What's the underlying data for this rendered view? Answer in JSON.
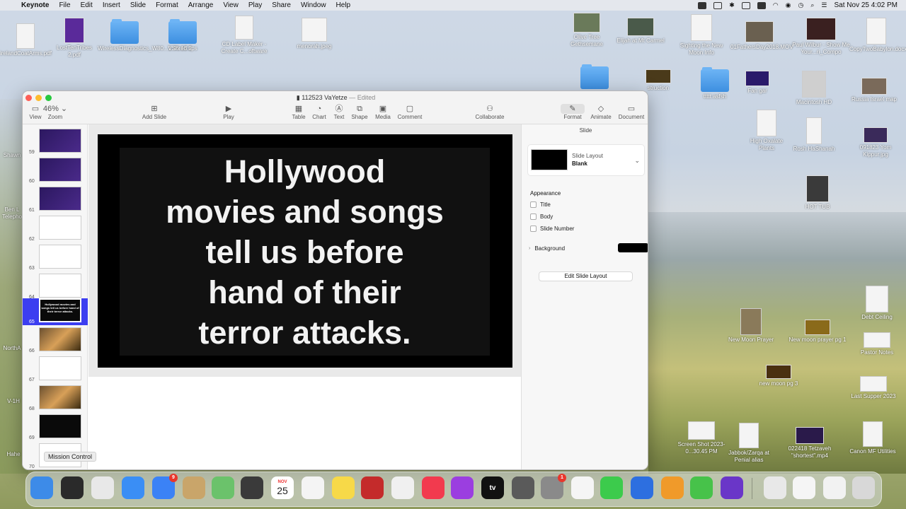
{
  "menubar": {
    "app": "Keynote",
    "items": [
      "File",
      "Edit",
      "Insert",
      "Slide",
      "Format",
      "Arrange",
      "View",
      "Play",
      "Share",
      "Window",
      "Help"
    ],
    "datetime": "Sat Nov 25  4:02 PM"
  },
  "desktop": {
    "icons": [
      {
        "label": "irelandCoatArms.pdf",
        "kind": "doc"
      },
      {
        "label": "LostTenTribes 2.pdf",
        "kind": "photo"
      },
      {
        "label": "WirelessDiagnostics_W80...1.46.15.2",
        "kind": "folder"
      },
      {
        "label": "VShred tips",
        "kind": "folder"
      },
      {
        "label": "CD Label Maker - Create C...oftware",
        "kind": "doc"
      },
      {
        "label": "menorah.jpeg",
        "kind": "doc"
      },
      {
        "label": "Olive Tree Gethsemane",
        "kind": "photo"
      },
      {
        "label": "Elijah at Mt Carmel",
        "kind": "photo"
      },
      {
        "label": "Sighting the New Moon Info",
        "kind": "doc"
      },
      {
        "label": "01FathersDay2018.MOV",
        "kind": "photo"
      },
      {
        "label": "Paul Wilbur - Show Me Your...ri_Compo",
        "kind": "photo"
      },
      {
        "label": "CopyTwoBabylon.docx",
        "kind": "doc"
      },
      {
        "label": "Fan gar",
        "kind": "photo"
      },
      {
        "label": "Macintosh HD",
        "kind": "doc"
      },
      {
        "label": "Russia Israel map",
        "kind": "photo"
      },
      {
        "label": "High Oxalate Plants",
        "kind": "doc"
      },
      {
        "label": "Rosh HaShanah",
        "kind": "doc"
      },
      {
        "label": "091823 Yom Kippur.jpg",
        "kind": "photo"
      },
      {
        "label": "HOT TUB",
        "kind": "doc"
      },
      {
        "label": "Debt Ceiling",
        "kind": "doc"
      },
      {
        "label": "New Moon Prayer",
        "kind": "doc"
      },
      {
        "label": "New moon prayer pg 1",
        "kind": "photo"
      },
      {
        "label": "Pastor Notes",
        "kind": "doc"
      },
      {
        "label": "new moon pg 3",
        "kind": "photo"
      },
      {
        "label": "Last Supper 2023",
        "kind": "doc"
      },
      {
        "label": "Screen Shot 2023-0...30.45 PM",
        "kind": "doc"
      },
      {
        "label": "Jabbok/Zarqa at Penial alias",
        "kind": "doc"
      },
      {
        "label": "022418 Tetzaveh \"shortest\".mp4",
        "kind": "photo"
      },
      {
        "label": "Canon MF Utilities",
        "kind": "doc"
      },
      {
        "label": "struction",
        "kind": "photo"
      },
      {
        "label": "ttttt.asfsh",
        "kind": "folder"
      },
      {
        "label": "Shawn",
        "kind": "doc"
      },
      {
        "label": "Ben L Telepho",
        "kind": "doc"
      },
      {
        "label": "NorthA",
        "kind": "doc"
      },
      {
        "label": "V-1H",
        "kind": "doc"
      },
      {
        "label": "Hahe",
        "kind": "doc"
      }
    ]
  },
  "window": {
    "title": "112523 VaYetze",
    "status": "Edited",
    "toolbar": {
      "view": "View",
      "zoom_value": "46%",
      "zoom": "Zoom",
      "add_slide": "Add Slide",
      "play": "Play",
      "table": "Table",
      "chart": "Chart",
      "text": "Text",
      "shape": "Shape",
      "media": "Media",
      "comment": "Comment",
      "collaborate": "Collaborate",
      "format": "Format",
      "animate": "Animate",
      "document": "Document"
    },
    "navigator": [
      {
        "num": "59",
        "style": "purple",
        "text": ""
      },
      {
        "num": "60",
        "style": "purple",
        "text": ""
      },
      {
        "num": "61",
        "style": "purple",
        "text": ""
      },
      {
        "num": "62",
        "style": "white",
        "text": ""
      },
      {
        "num": "63",
        "style": "white",
        "text": ""
      },
      {
        "num": "64",
        "style": "white",
        "text": ""
      },
      {
        "num": "65",
        "style": "black",
        "text": "Hollywood movies and songs tell us before hand of their terror attacks.",
        "selected": true
      },
      {
        "num": "66",
        "style": "photo",
        "text": ""
      },
      {
        "num": "67",
        "style": "white",
        "text": ""
      },
      {
        "num": "68",
        "style": "photo",
        "text": ""
      },
      {
        "num": "69",
        "style": "black",
        "text": ""
      },
      {
        "num": "70",
        "style": "white",
        "text": ""
      }
    ],
    "slide": {
      "text": "Hollywood\nmovies and songs\ntell us before\nhand of their\nterror attacks."
    },
    "inspector": {
      "header": "Slide",
      "layout_label": "Slide Layout",
      "layout_name": "Blank",
      "appearance": "Appearance",
      "options": [
        {
          "label": "Title",
          "checked": false
        },
        {
          "label": "Body",
          "checked": false
        },
        {
          "label": "Slide Number",
          "checked": false
        }
      ],
      "background_label": "Background",
      "background_color": "#000000",
      "edit_layout": "Edit Slide Layout"
    }
  },
  "tooltip": "Mission Control",
  "dock": {
    "apps": [
      {
        "name": "finder-icon",
        "color": "#3d8be8"
      },
      {
        "name": "mission-control-icon",
        "color": "#2a2a2a"
      },
      {
        "name": "launchpad-icon",
        "color": "#e8e8e8"
      },
      {
        "name": "safari-icon",
        "color": "#3a8ef5"
      },
      {
        "name": "mail-icon",
        "color": "#3b82f6",
        "badge": "9"
      },
      {
        "name": "contacts-icon",
        "color": "#c9a56a"
      },
      {
        "name": "maps-icon",
        "color": "#6bc26b"
      },
      {
        "name": "calculator-icon",
        "color": "#3a3a3a"
      },
      {
        "name": "calendar-icon",
        "color": "#ffffff",
        "label": "25",
        "month": "NOV"
      },
      {
        "name": "reminders-icon",
        "color": "#f4f4f4"
      },
      {
        "name": "notes-icon",
        "color": "#f7d948"
      },
      {
        "name": "photo-booth-icon",
        "color": "#c42b2b"
      },
      {
        "name": "photos-icon",
        "color": "#f0f0f0"
      },
      {
        "name": "music-icon",
        "color": "#f23a4e"
      },
      {
        "name": "podcasts-icon",
        "color": "#9b3ee0"
      },
      {
        "name": "tv-icon",
        "color": "#111111",
        "label": "tv"
      },
      {
        "name": "preview-icon",
        "color": "#5a5a5a"
      },
      {
        "name": "system-settings-icon",
        "color": "#8a8a8a",
        "badge": "1"
      },
      {
        "name": "pages-icon",
        "color": "#f5f5f5"
      },
      {
        "name": "messages-icon",
        "color": "#3ccb4c"
      },
      {
        "name": "keynote-icon",
        "color": "#2d6fe0"
      },
      {
        "name": "garageband-icon",
        "color": "#f09a2a"
      },
      {
        "name": "backup-icon",
        "color": "#47c24a"
      },
      {
        "name": "imovie-icon",
        "color": "#6a36c8"
      },
      {
        "name": "downloads-icon",
        "color": "#e8e8e8"
      },
      {
        "name": "documents-stack-icon",
        "color": "#f5f5f5"
      },
      {
        "name": "screenshot-stack-icon",
        "color": "#f2f2f2"
      },
      {
        "name": "trash-icon",
        "color": "#d8d8d8"
      }
    ]
  }
}
